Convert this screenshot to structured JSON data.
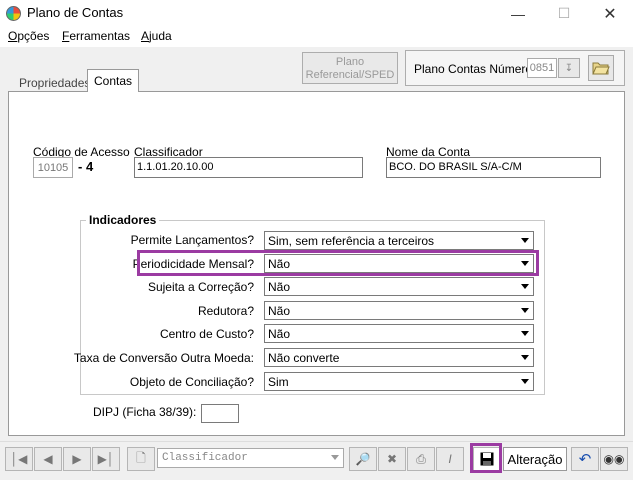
{
  "window": {
    "title": "Plano de Contas"
  },
  "menu": [
    {
      "pre": "",
      "ul": "O",
      "post": "pções"
    },
    {
      "pre": "",
      "ul": "F",
      "post": "erramentas"
    },
    {
      "pre": "",
      "ul": "A",
      "post": "juda"
    }
  ],
  "tabs": {
    "propriedades": "Propriedades",
    "contas": "Contas"
  },
  "header": {
    "ref_button_line1": "Plano",
    "ref_button_line2": "Referencial/SPED",
    "plano_label": "Plano Contas Número",
    "plano_value": "0851"
  },
  "fields": {
    "codigo_label": "Código de Acesso",
    "codigo_value": "10105",
    "codigo_digit": "- 4",
    "classificador_label": "Classificador",
    "classificador_value": "1.1.01.20.10.00",
    "nome_label": "Nome da Conta",
    "nome_value": "BCO. DO BRASIL S/A-C/M"
  },
  "indicadores": {
    "title": "Indicadores",
    "rows": [
      {
        "label": "Permite Lançamentos?",
        "value": "Sim, sem referência a terceiros"
      },
      {
        "label": "Periodicidade Mensal?",
        "value": "Não"
      },
      {
        "label": "Sujeita a Correção?",
        "value": "Não"
      },
      {
        "label": "Redutora?",
        "value": "Não"
      },
      {
        "label": "Centro de Custo?",
        "value": "Não"
      },
      {
        "label": "Taxa de Conversão Outra Moeda:",
        "value": "Não converte"
      },
      {
        "label": "Objeto de Conciliação?",
        "value": "Sim"
      }
    ]
  },
  "dipj": {
    "label": "DIPJ (Ficha 38/39):",
    "value": ""
  },
  "toolbar": {
    "search_placeholder": "Classificador",
    "status": "Alteração"
  },
  "colors": {
    "highlight": "#9b3ba2"
  }
}
